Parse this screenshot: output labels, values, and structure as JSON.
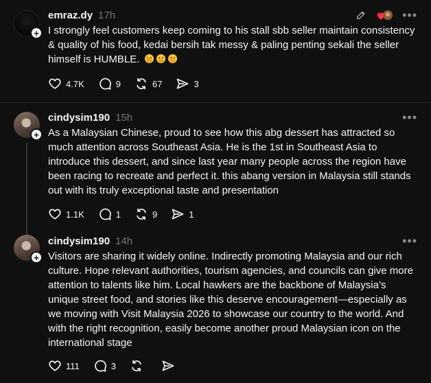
{
  "posts": [
    {
      "username": "emraz.dy",
      "time": "17h",
      "text": "I strongly feel customers keep coming to his stall sbb seller maintain consistency & quality of his food, kedai bersih tak messy & paling penting sekali the seller himself is HUMBLE.",
      "emoji_icons": [
        "face-with-hand-emoji",
        "face-with-hand-emoji",
        "face-with-hand-emoji"
      ],
      "likes": "4.7K",
      "replies": "9",
      "reposts": "67",
      "shares": "3"
    },
    {
      "username": "cindysim190",
      "time": "15h",
      "text": "As a Malaysian Chinese,  proud to see how this abg dessert has attracted so much attention across Southeast Asia. He is the 1st in Southeast Asia to introduce this dessert, and since last year many people across the region have been racing to recreate and perfect it. this abang version in Malaysia still stands out with its truly exceptional taste and presentation",
      "likes": "1.1K",
      "replies": "1",
      "reposts": "9",
      "shares": "1"
    },
    {
      "username": "cindysim190",
      "time": "14h",
      "text": "Visitors are sharing it widely online. Indirectly promoting Malaysia and our rich culture. Hope relevant authorities, tourism agencies, and councils can give more attention to talents like him. Local hawkers are the backbone of Malaysia’s unique street food, and stories like this deserve encouragement—especially as we moving with Visit Malaysia 2026 to showcase our country to the world. And with the right recognition, easily become another proud Malaysian icon on the international stage",
      "likes": "111",
      "replies": "3",
      "reposts": "",
      "shares": ""
    }
  ],
  "icons": {
    "more": "•••",
    "follow": "+"
  },
  "colors": {
    "background": "#101010",
    "text": "#f3f5f7",
    "muted": "#777777",
    "like_heart": "#ff3040"
  }
}
